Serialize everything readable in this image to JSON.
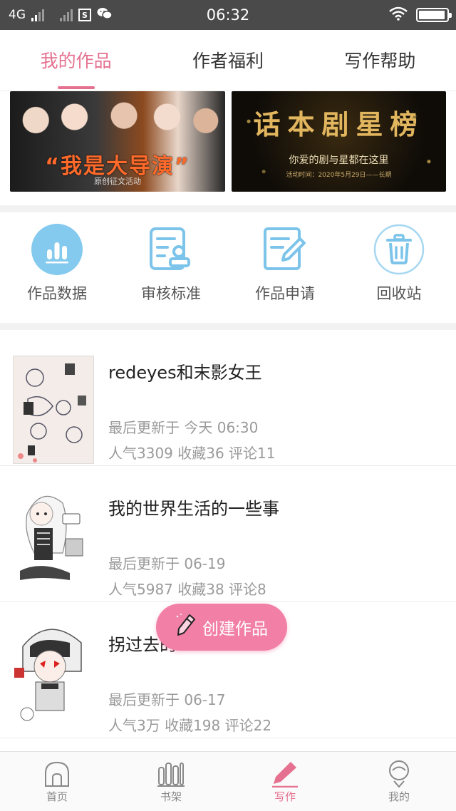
{
  "status_bar": {
    "network": "4G",
    "sim_icon_text": "S",
    "time": "06:32"
  },
  "tabs": [
    {
      "label": "我的作品",
      "active": true
    },
    {
      "label": "作者福利",
      "active": false
    },
    {
      "label": "写作帮助",
      "active": false
    }
  ],
  "banners": [
    {
      "title": "“我是大导演”",
      "subtitle": "原创征文活动"
    },
    {
      "title": "话本剧星榜",
      "subtitle": "你爱的剧与星都在这里",
      "date": "活动时间：2020年5月29日——长期"
    }
  ],
  "actions": [
    {
      "label": "作品数据",
      "icon": "bar-chart-icon"
    },
    {
      "label": "审核标准",
      "icon": "review-standard-icon"
    },
    {
      "label": "作品申请",
      "icon": "edit-document-icon"
    },
    {
      "label": "回收站",
      "icon": "trash-icon"
    }
  ],
  "works": [
    {
      "title": "redeyes和末影女王",
      "updated": "最后更新于 今天 06:30",
      "stats": "人气3309 收藏36 评论11"
    },
    {
      "title": "我的世界生活的一些事",
      "updated": "最后更新于 06-19",
      "stats": "人气5987 收藏38 评论8"
    },
    {
      "title": "拐过去的",
      "updated": "最后更新于 06-17",
      "stats": "人气3万 收藏198 评论22"
    }
  ],
  "fab": {
    "label": "创建作品",
    "color": "#f27fa6"
  },
  "bottom_nav": [
    {
      "label": "首页",
      "icon": "home-icon",
      "active": false
    },
    {
      "label": "书架",
      "icon": "bookshelf-icon",
      "active": false
    },
    {
      "label": "写作",
      "icon": "pen-icon",
      "active": true
    },
    {
      "label": "我的",
      "icon": "profile-icon",
      "active": false
    }
  ],
  "colors": {
    "accent": "#e5708f",
    "icon_blue": "#7cc4ea"
  }
}
